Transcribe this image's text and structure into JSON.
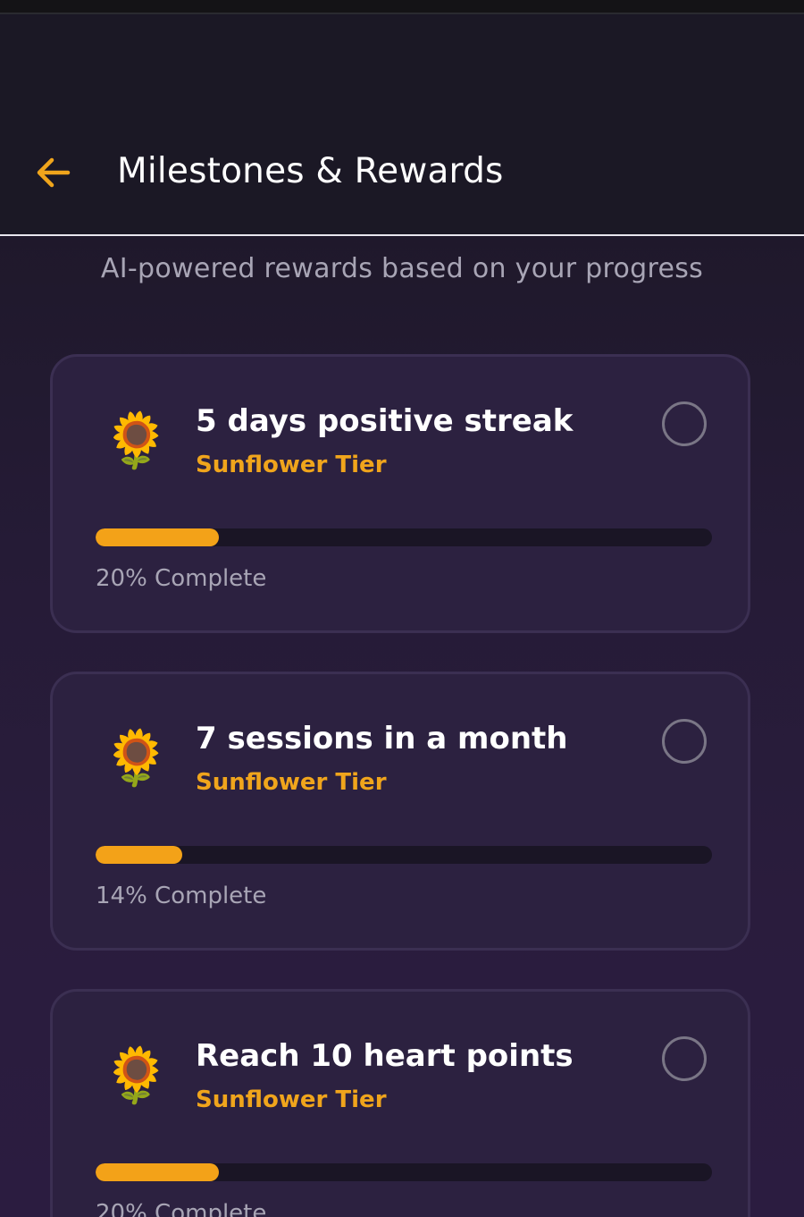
{
  "header": {
    "back_icon": "arrow-left-icon",
    "title": "Milestones & Rewards",
    "accent_color": "#f0a51c"
  },
  "subtitle": "AI-powered rewards based on your progress",
  "milestones": [
    {
      "icon": "🌻",
      "title": "5 days positive streak",
      "tier": "Sunflower Tier",
      "progress": 0.2,
      "progress_label": "20% Complete",
      "completed": false
    },
    {
      "icon": "🌻",
      "title": "7 sessions in a month",
      "tier": "Sunflower Tier",
      "progress": 0.14,
      "progress_label": "14% Complete",
      "completed": false
    },
    {
      "icon": "🌻",
      "title": "Reach 10 heart points",
      "tier": "Sunflower Tier",
      "progress": 0.2,
      "progress_label": "20% Complete",
      "completed": false
    }
  ]
}
